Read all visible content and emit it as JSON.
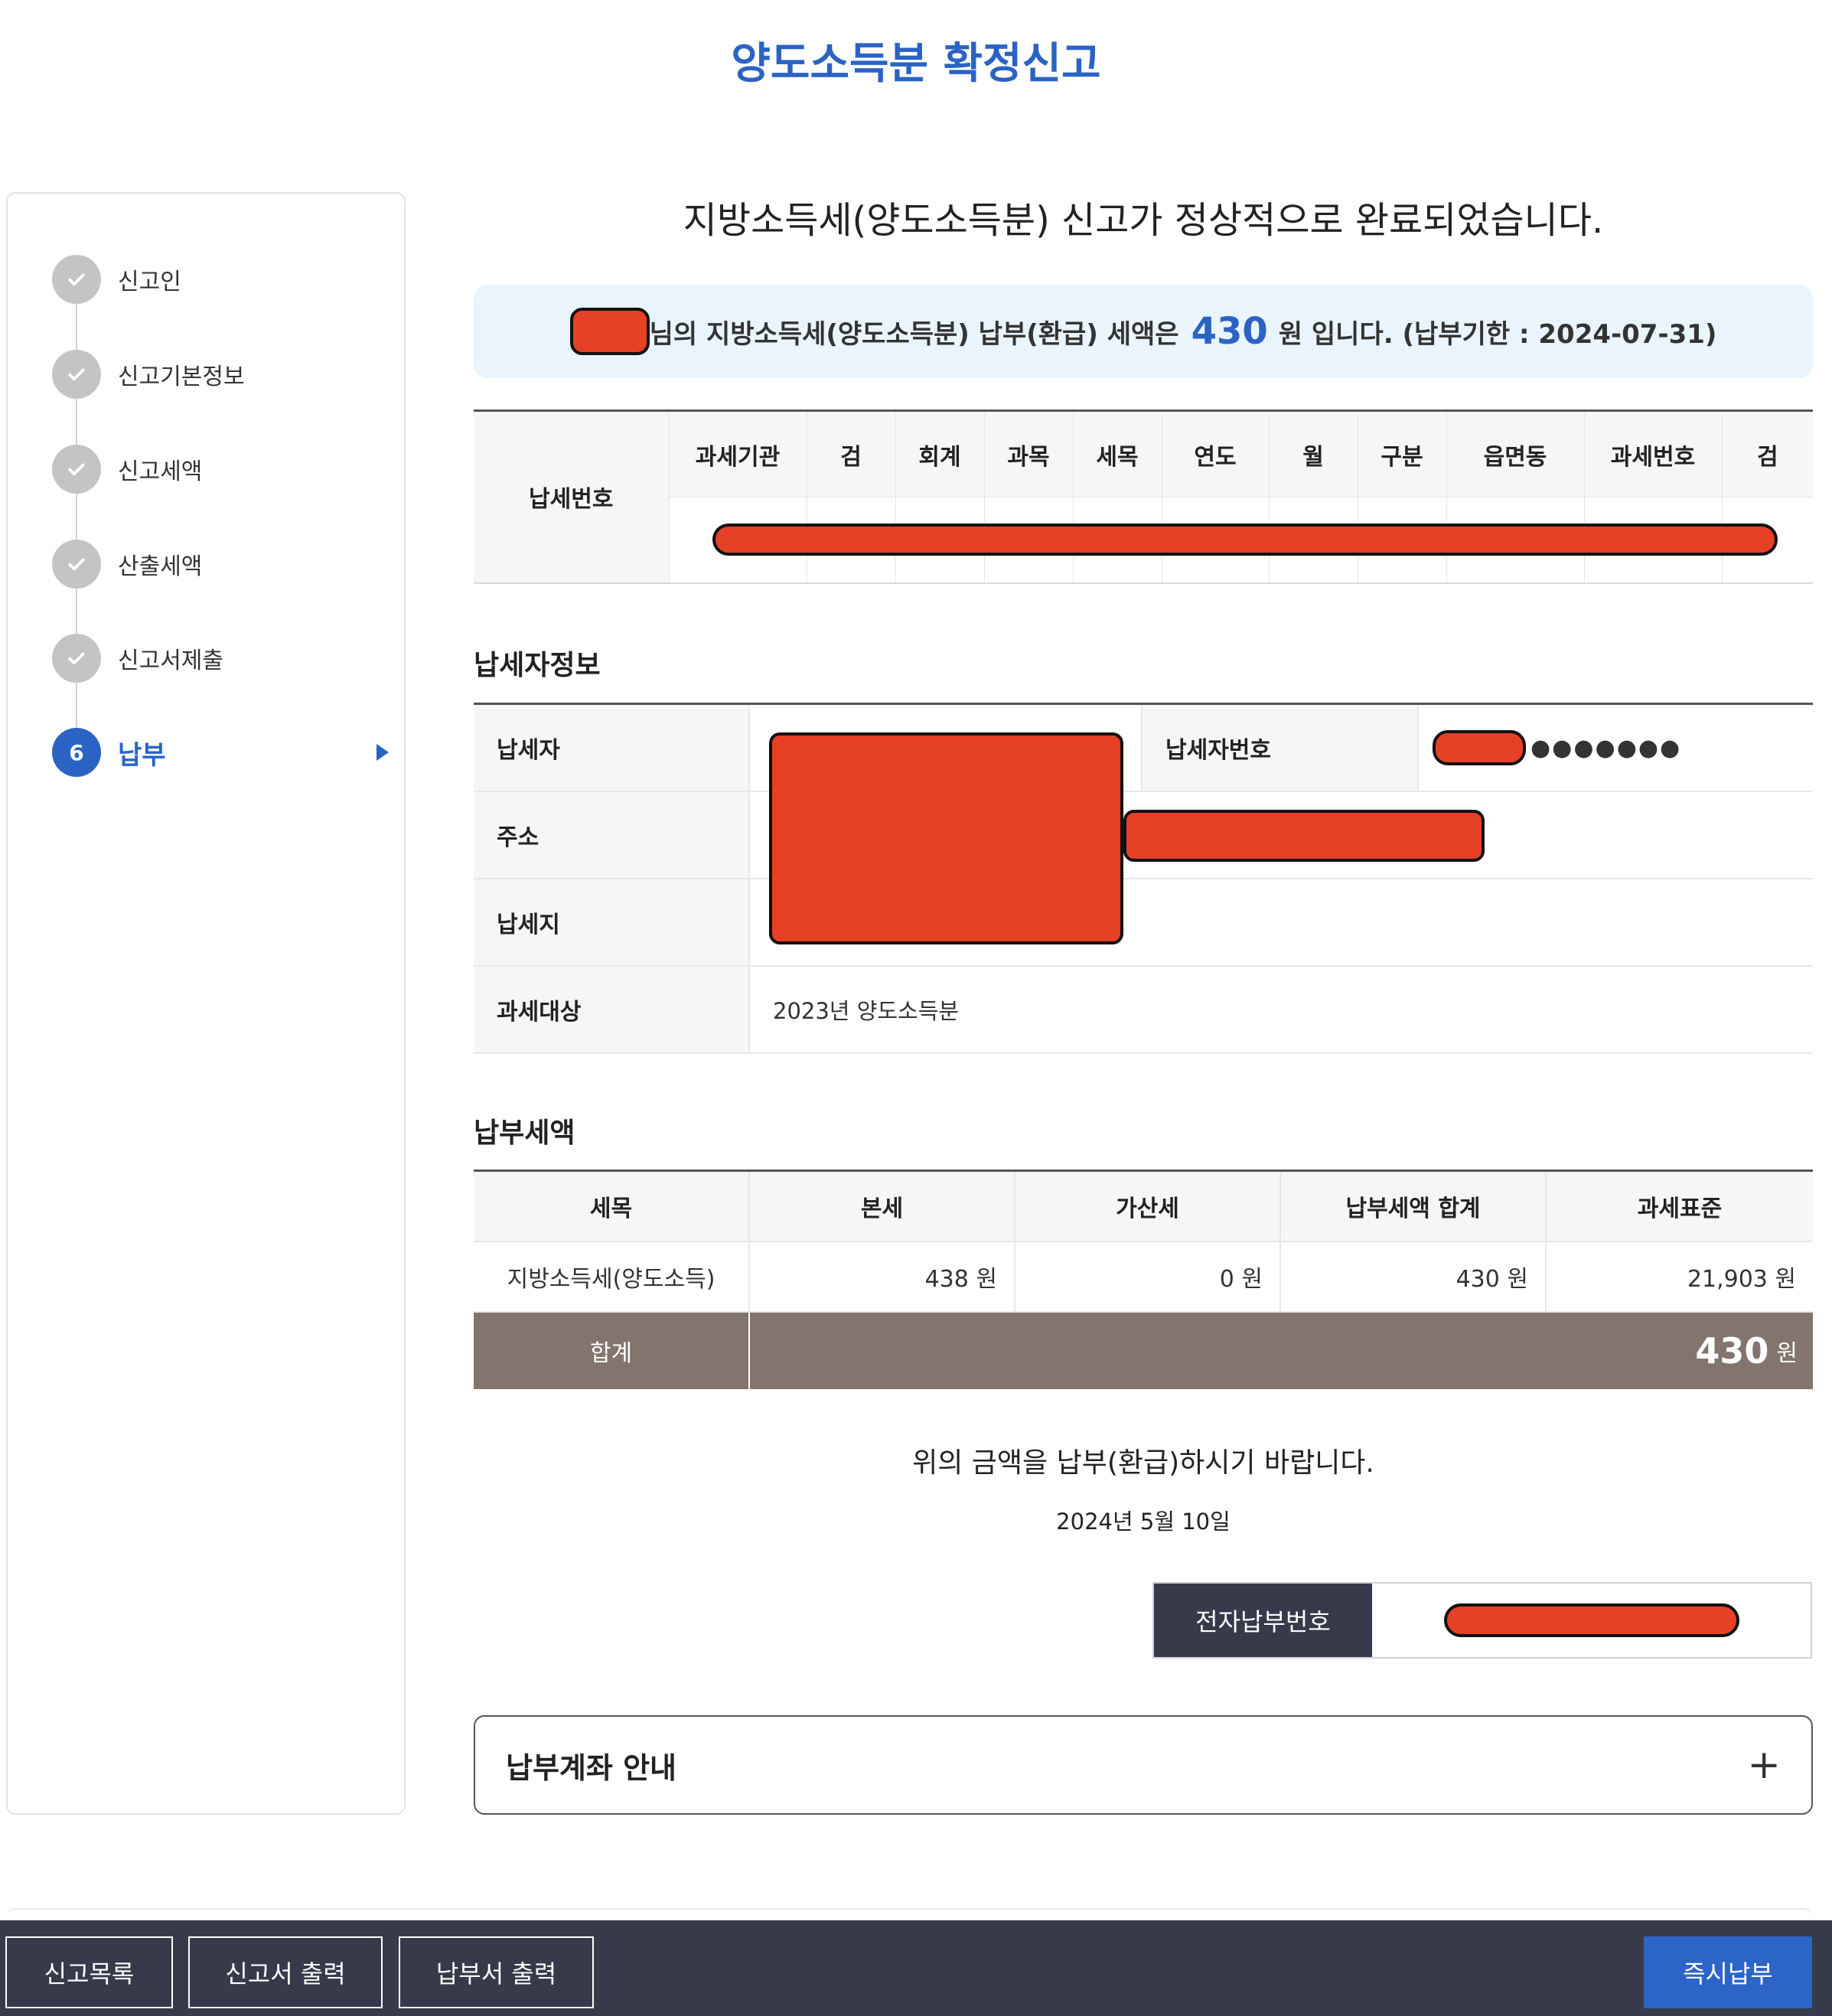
{
  "page_title": "양도소득분 확정신고",
  "steps": [
    {
      "label": "신고인"
    },
    {
      "label": "신고기본정보"
    },
    {
      "label": "신고세액"
    },
    {
      "label": "산출세액"
    },
    {
      "label": "신고서제출"
    },
    {
      "label": "납부",
      "number": "6"
    }
  ],
  "complete_message": "지방소득세(양도소득분) 신고가 정상적으로 완료되었습니다.",
  "banner": {
    "prefix": "님의 지방소득세(양도소득분) 납부(환급) 세액은",
    "amount": "430",
    "suffix": "원 입니다. (납부기한 : 2024-07-31)"
  },
  "tax_number": {
    "label": "납세번호",
    "columns": [
      "과세기관",
      "검",
      "회계",
      "과목",
      "세목",
      "연도",
      "월",
      "구분",
      "읍면동",
      "과세번호",
      "검"
    ]
  },
  "taxpayer_info": {
    "heading": "납세자정보",
    "taxpayer_label": "납세자",
    "taxpayer_no_label": "납세자번호",
    "taxpayer_no_masked": "●●●●●●●",
    "address_label": "주소",
    "tax_location_label": "납세지",
    "tax_target_label": "과세대상",
    "tax_target_value": "2023년 양도소득분"
  },
  "payment": {
    "heading": "납부세액",
    "columns": [
      "세목",
      "본세",
      "가산세",
      "납부세액 합계",
      "과세표준"
    ],
    "rows": [
      [
        "지방소득세(양도소득)",
        "438 원",
        "0 원",
        "430 원",
        "21,903 원"
      ]
    ],
    "total_label": "합계",
    "total_amount": "430",
    "total_unit": "원"
  },
  "closing_note": "위의 금액을 납부(환급)하시기 바랍니다.",
  "date": "2024년 5월 10일",
  "epay_label": "전자납부번호",
  "account_guide": "납부계좌 안내",
  "account_toggle": "+",
  "buttons": {
    "list": "신고목록",
    "print_report": "신고서 출력",
    "print_bill": "납부서 출력",
    "pay_now": "즉시납부"
  },
  "colors": {
    "accent": "#2a63c4",
    "total_bar": "#83756d",
    "footer": "#363a4a",
    "redaction": "#e64027"
  }
}
